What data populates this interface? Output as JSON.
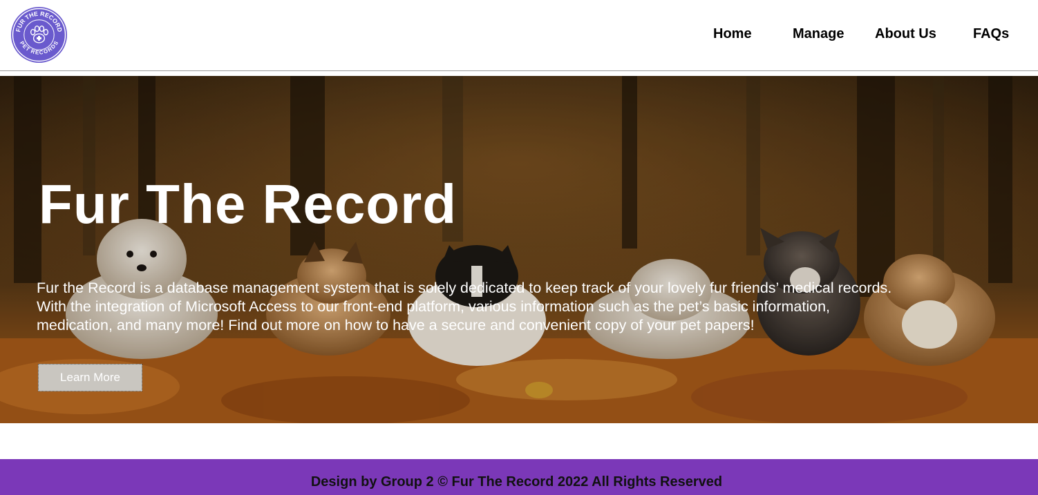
{
  "brand": {
    "logo_top_text": "FUR THE RECORD",
    "logo_bottom_text": "PET RECORDS",
    "logo_color": "#6a5acd"
  },
  "nav": {
    "items": [
      {
        "label": "Home"
      },
      {
        "label": "Manage"
      },
      {
        "label": "About Us"
      },
      {
        "label": "FAQs"
      }
    ]
  },
  "hero": {
    "title": "Fur The Record",
    "description": "Fur the Record is a database management system that is solely dedicated to keep track of your lovely fur friends’ medical records. With the integration of Microsoft Access to our front-end platform, various information such as the pet’s basic information, medication, and many more! Find out more on how to have a secure and convenient copy of your pet papers!",
    "button_label": "Learn More",
    "background_image": "dogs-in-autumn-leaves"
  },
  "footer": {
    "text": "Design by Group 2 © Fur The Record 2022 All Rights Reserved",
    "color": "#7b38b8"
  }
}
